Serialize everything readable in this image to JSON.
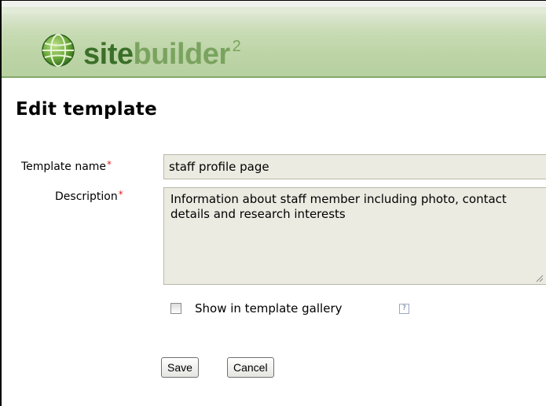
{
  "header": {
    "logo_site": "site",
    "logo_builder": "builder",
    "logo_version": "2",
    "logo_icon": "globe-icon"
  },
  "page": {
    "title": "Edit template"
  },
  "form": {
    "name_label": "Template name",
    "description_label": "Description",
    "required_marker": "*",
    "name_value": "staff profile page",
    "description_value": "Information about staff member including photo, contact details and research interests",
    "gallery_label": "Show in template gallery",
    "gallery_checked": false,
    "help_glyph": "?",
    "save_label": "Save",
    "cancel_label": "Cancel"
  },
  "colors": {
    "header_green": "#b7d0a0",
    "logo_dark_green": "#3b6f29",
    "required_red": "#d22222",
    "field_bg": "#ecebe2"
  }
}
